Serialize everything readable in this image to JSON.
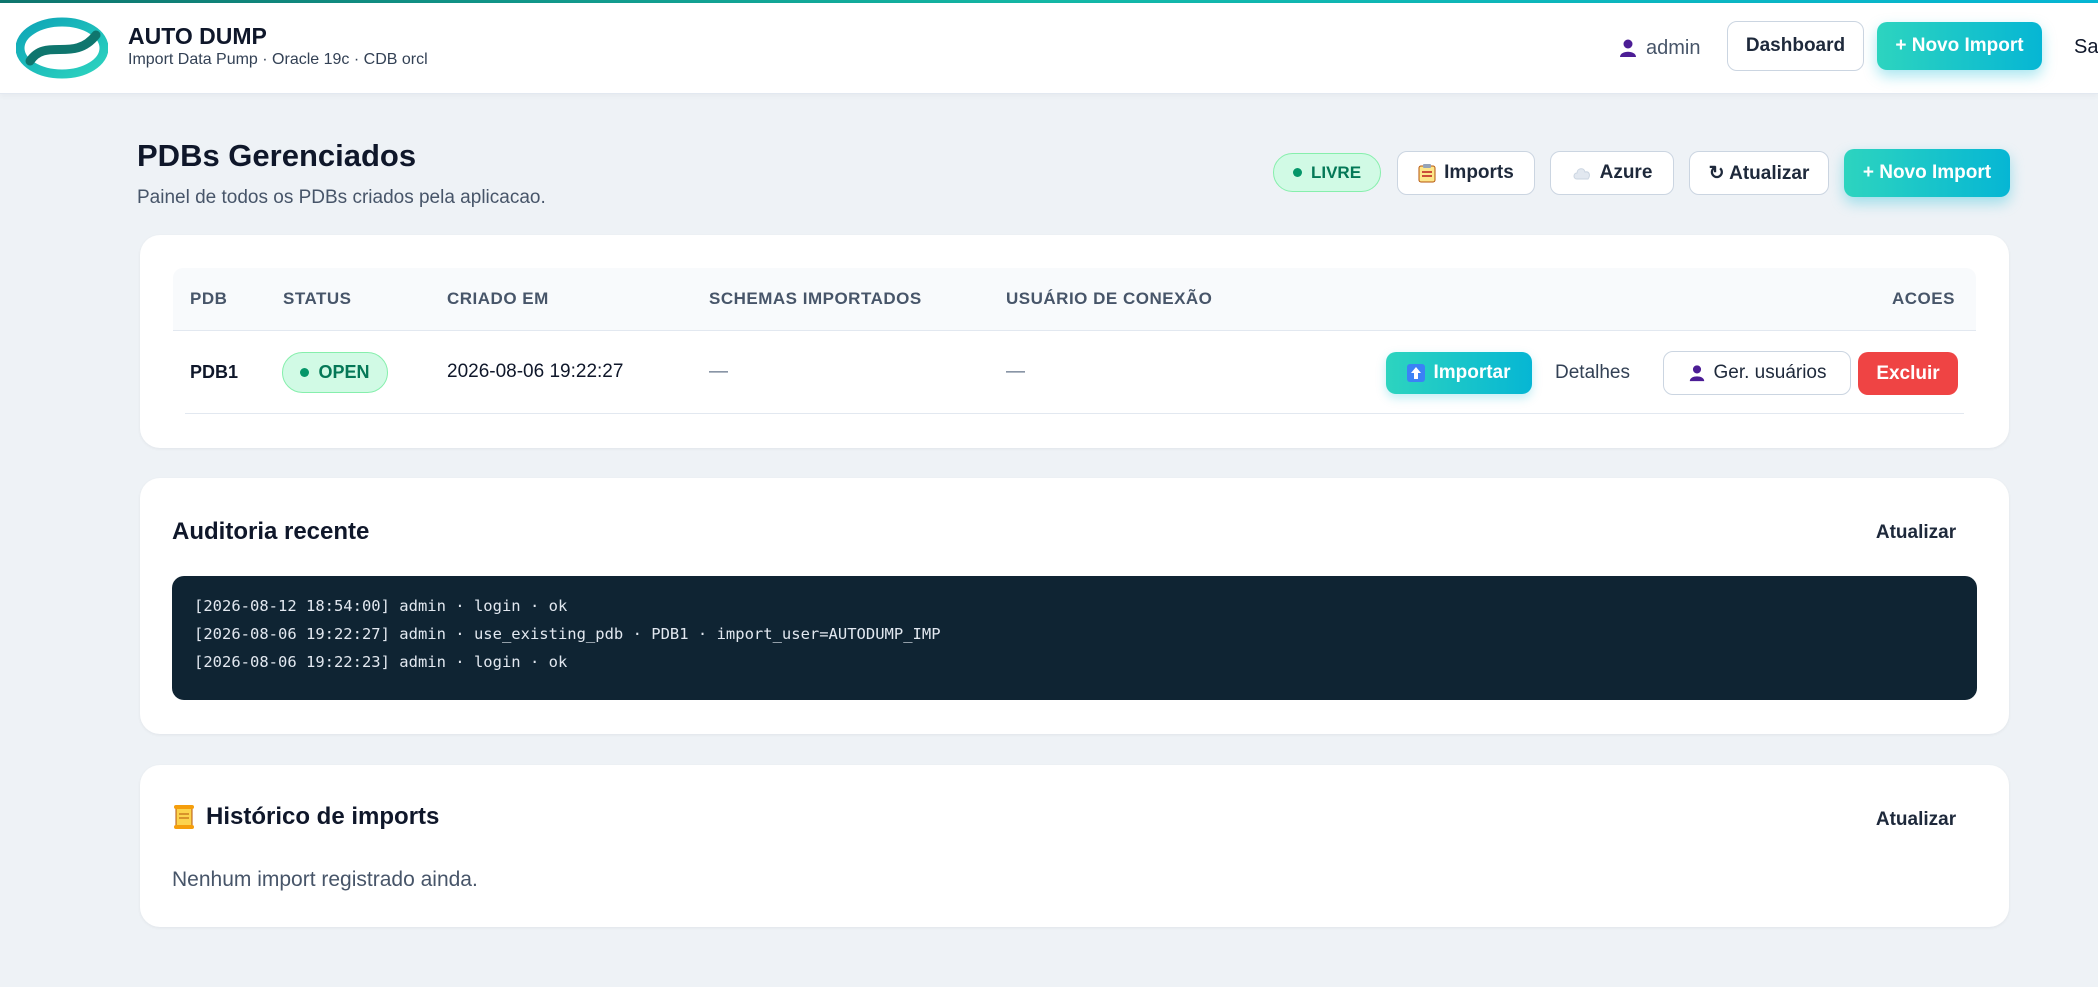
{
  "app": {
    "title": "AUTO DUMP",
    "subtitle": "Import Data Pump · Oracle 19c · CDB orcl"
  },
  "topbar": {
    "user": "admin",
    "dashboard_label": "Dashboard",
    "new_import_label": "+ Novo Import",
    "cut_link": "Sa"
  },
  "page": {
    "title": "PDBs Gerenciados",
    "subtitle": "Painel de todos os PDBs criados pela aplicacao.",
    "status_pill": "LIVRE",
    "imports_label": "Imports",
    "azure_label": "Azure",
    "refresh_label": "↻ Atualizar",
    "new_import_label": "+ Novo Import"
  },
  "pdb_table": {
    "headers": [
      "PDB",
      "STATUS",
      "CRIADO EM",
      "SCHEMAS IMPORTADOS",
      "USUÁRIO DE CONEXÃO",
      "ACOES"
    ],
    "rows": [
      {
        "pdb": "PDB1",
        "status": "OPEN",
        "created": "2026-08-06 19:22:27",
        "schemas": "—",
        "user": "—",
        "actions": {
          "import": "Importar",
          "details": "Detalhes",
          "users": "Ger. usuários",
          "delete": "Excluir"
        }
      }
    ]
  },
  "audit": {
    "title": "Auditoria recente",
    "refresh_label": "Atualizar",
    "lines": [
      "[2026-08-12 18:54:00] admin · login · ok",
      "[2026-08-06 19:22:27] admin · use_existing_pdb · PDB1 · import_user=AUTODUMP_IMP",
      "[2026-08-06 19:22:23] admin · login · ok"
    ]
  },
  "history": {
    "title": "Histórico de imports",
    "refresh_label": "Atualizar",
    "empty": "Nenhum import registrado ainda."
  },
  "icons": {
    "user": "user-icon",
    "imports": "clipboard-icon",
    "azure": "cloud-icon",
    "import": "upload-arrow-icon",
    "history": "scroll-icon"
  },
  "colors": {
    "accent_start": "#2dd4bf",
    "accent_end": "#06b6d4",
    "danger": "#ef4444",
    "success_bg": "#d1fae5",
    "success_text": "#047857",
    "log_bg": "#0f2433"
  }
}
